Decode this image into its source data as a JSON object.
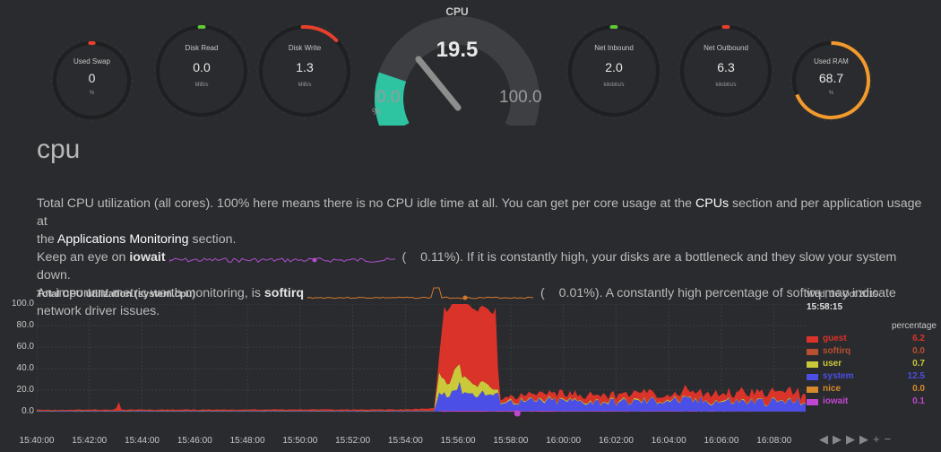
{
  "gauges": [
    {
      "title": "Used Swap",
      "value": "0",
      "unit": "%",
      "accent": "#e8402d",
      "level": 0.0
    },
    {
      "title": "Disk Read",
      "value": "0.0",
      "unit": "MiB/s",
      "accent": "#5fca35",
      "level": 0.0
    },
    {
      "title": "Disk Write",
      "value": "1.3",
      "unit": "MiB/s",
      "accent": "#e8402d",
      "level": 0.12
    },
    {
      "title": "Net Inbound",
      "value": "2.0",
      "unit": "kilobits/s",
      "accent": "#5fca35",
      "level": 0.0
    },
    {
      "title": "Net Outbound",
      "value": "6.3",
      "unit": "kilobits/s",
      "accent": "#e8402d",
      "level": 0.0
    },
    {
      "title": "Used RAM",
      "value": "68.7",
      "unit": "%",
      "accent": "#f29a2e",
      "level": 0.687
    }
  ],
  "cpu_gauge": {
    "title": "CPU",
    "value": "19.5",
    "min": "0.0",
    "max": "100.0",
    "unit": "%",
    "accent": "#2ec4a2",
    "level": 0.195
  },
  "section": {
    "title": "cpu",
    "line1_a": "Total CPU utilization (all cores). 100% here means there is no CPU idle time at all. You can get per core usage at the ",
    "line1_link": "CPUs",
    "line1_b": " section and per application usage at",
    "line2_a": "the ",
    "line2_link": "Applications Monitoring",
    "line2_b": " section.",
    "iowait_pre": "Keep an eye on ",
    "iowait_label": "iowait",
    "iowait_paren": "(",
    "iowait_val": "0.11%). If it is constantly high, your disks are a bottleneck and they slow your system down.",
    "softirq_pre": "An important metric worth monitoring, is ",
    "softirq_label": "softirq",
    "softirq_paren": "(",
    "softirq_val": "0.01%). A constantly high percentage of softirq may indicate",
    "softirq_tail": "network driver issues."
  },
  "chart_data": {
    "type": "area",
    "title": "Total CPU utilization (system.cpu)",
    "ylabel": "percentage",
    "ylim": [
      0,
      100
    ],
    "yticks": [
      "100.0",
      "80.0",
      "60.0",
      "40.0",
      "20.0",
      "0.0"
    ],
    "xticks": [
      "15:40:00",
      "15:42:00",
      "15:44:00",
      "15:46:00",
      "15:48:00",
      "15:50:00",
      "15:52:00",
      "15:54:00",
      "15:56:00",
      "15:58:00",
      "16:00:00",
      "16:02:00",
      "16:04:00",
      "16:06:00",
      "16:08:00"
    ],
    "x_start_min": 0,
    "x_end_min": 29.2,
    "series": [
      {
        "name": "iowait",
        "color": "#c246d4",
        "knots": [
          [
            0,
            0.1
          ],
          [
            15.2,
            0.1
          ],
          [
            15.4,
            1
          ],
          [
            29.2,
            0.1
          ]
        ]
      },
      {
        "name": "nice",
        "color": "#d68a2c",
        "knots": [
          [
            0,
            0
          ],
          [
            29.2,
            0
          ]
        ]
      },
      {
        "name": "system",
        "color": "#4b4fe6",
        "knots": [
          [
            0,
            0.5
          ],
          [
            15.1,
            0.5
          ],
          [
            15.3,
            18
          ],
          [
            15.6,
            16
          ],
          [
            16,
            22
          ],
          [
            16.5,
            15
          ],
          [
            17,
            16
          ],
          [
            17.4,
            14
          ],
          [
            17.6,
            10
          ],
          [
            18,
            8
          ],
          [
            20,
            9
          ],
          [
            22,
            8
          ],
          [
            24,
            10
          ],
          [
            26,
            9
          ],
          [
            28,
            9
          ],
          [
            29.2,
            9
          ]
        ]
      },
      {
        "name": "user",
        "color": "#c9c93a",
        "knots": [
          [
            0,
            0.3
          ],
          [
            15.1,
            0.3
          ],
          [
            15.3,
            18
          ],
          [
            15.6,
            10
          ],
          [
            16,
            20
          ],
          [
            16.5,
            9
          ],
          [
            17,
            10
          ],
          [
            17.5,
            3
          ],
          [
            17.6,
            1
          ],
          [
            20,
            1
          ],
          [
            29.2,
            0.7
          ]
        ]
      },
      {
        "name": "softirq",
        "color": "#b6502e",
        "knots": [
          [
            0,
            0
          ],
          [
            29.2,
            0
          ]
        ]
      },
      {
        "name": "guest",
        "color": "#d9332a",
        "knots": [
          [
            0,
            0.8
          ],
          [
            3,
            1
          ],
          [
            3.1,
            8
          ],
          [
            3.2,
            1
          ],
          [
            14,
            1.2
          ],
          [
            15.1,
            2
          ],
          [
            15.3,
            20
          ],
          [
            15.5,
            60
          ],
          [
            15.6,
            70
          ],
          [
            16.5,
            70
          ],
          [
            17.4,
            70
          ],
          [
            17.6,
            3
          ],
          [
            18,
            4
          ],
          [
            20,
            6
          ],
          [
            22,
            6
          ],
          [
            24,
            7
          ],
          [
            26,
            7
          ],
          [
            28,
            8
          ],
          [
            29.2,
            6.2
          ]
        ]
      }
    ],
    "legend": {
      "date": "Wed, 16 Oct 2019",
      "time": "15:58:15",
      "unit": "percentage",
      "items": [
        {
          "name": "guest",
          "value": "6.2",
          "color": "#d9332a"
        },
        {
          "name": "softirq",
          "value": "0.0",
          "color": "#b6502e"
        },
        {
          "name": "user",
          "value": "0.7",
          "color": "#c9c93a"
        },
        {
          "name": "system",
          "value": "12.5",
          "color": "#4b4fe6"
        },
        {
          "name": "nice",
          "value": "0.0",
          "color": "#d68a2c"
        },
        {
          "name": "iowait",
          "value": "0.1",
          "color": "#c246d4"
        }
      ]
    }
  },
  "controls": {
    "glyphs": "◀▶▶▶+−"
  }
}
